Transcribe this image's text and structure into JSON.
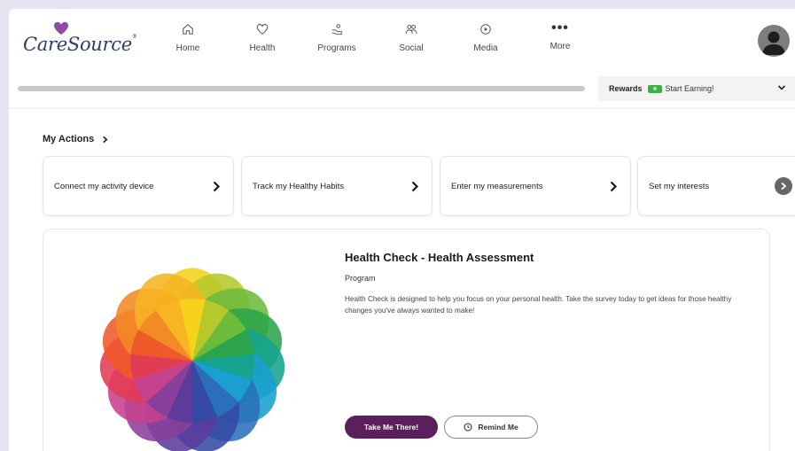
{
  "brand": {
    "logo_text": "CareSource",
    "logo_mark": "®",
    "heart_color": "#8e4ba3",
    "accent_color": "#5b1f5c"
  },
  "nav": {
    "items": [
      {
        "label": "Home",
        "icon": "home-icon"
      },
      {
        "label": "Health",
        "icon": "heart-icon"
      },
      {
        "label": "Programs",
        "icon": "programs-icon"
      },
      {
        "label": "Social",
        "icon": "people-icon"
      },
      {
        "label": "Media",
        "icon": "play-icon"
      },
      {
        "label": "More",
        "icon": "more-dots-icon",
        "glyph": "•••"
      }
    ]
  },
  "user": {
    "avatar_icon": "user-avatar-icon"
  },
  "progress": {
    "fraction": 0.0
  },
  "rewards": {
    "label": "Rewards",
    "status": "Start Earning!",
    "badge_color": "#3fae49",
    "icon": "chevron-down-icon"
  },
  "my_actions": {
    "title": "My Actions",
    "items": [
      {
        "label": "Connect my activity device"
      },
      {
        "label": "Track my Healthy Habits"
      },
      {
        "label": "Enter my measurements"
      },
      {
        "label": "Set my interests"
      }
    ],
    "next_icon": "chevron-right-circle-icon"
  },
  "program": {
    "title": "Health Check - Health Assessment",
    "type": "Program",
    "description": "Health Check is designed to help you focus on your personal health. Take the survey today to get ideas for those healthy changes you've always wanted to make!",
    "primary_button": "Take Me There!",
    "secondary_button": "Remind Me",
    "secondary_icon": "clock-icon",
    "image_icon": "rainbow-flower-icon",
    "petal_colors": [
      "#f6d21d",
      "#b7c92a",
      "#6dbb3b",
      "#2ba54b",
      "#15a38e",
      "#1a9fd0",
      "#2b6fbb",
      "#354aa5",
      "#5b3b9c",
      "#8a3f9d",
      "#c6428d",
      "#e23b55",
      "#ef5a2a",
      "#f38a25",
      "#f6b521"
    ]
  }
}
